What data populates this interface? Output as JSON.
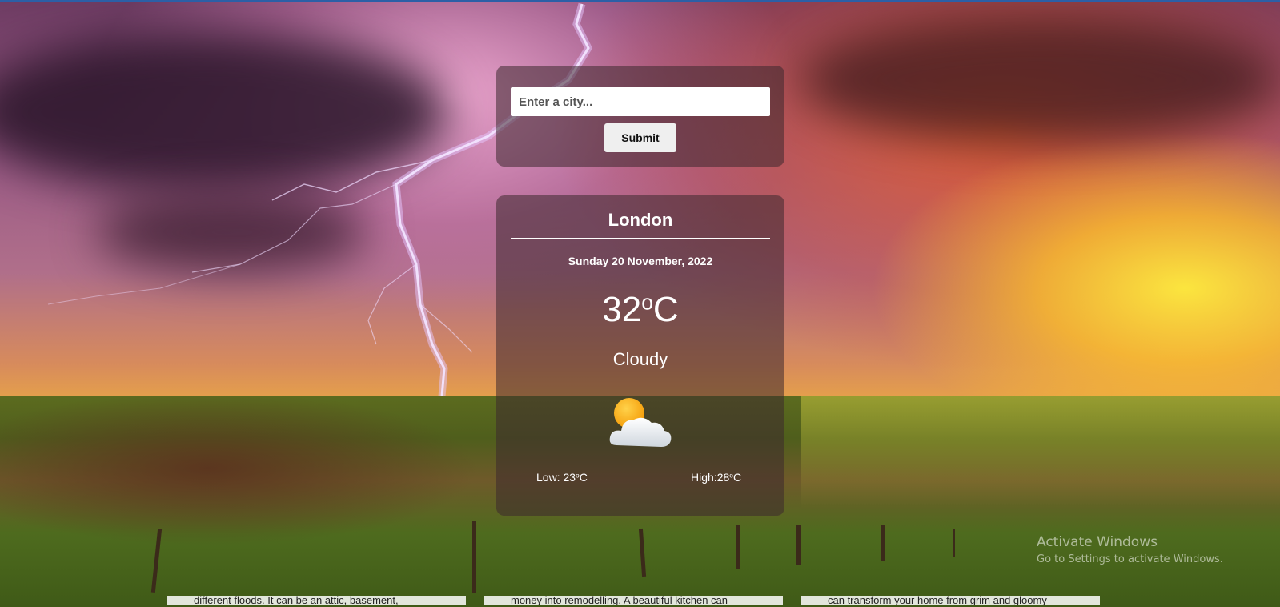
{
  "search": {
    "placeholder": "Enter a city...",
    "submit_label": "Submit"
  },
  "weather": {
    "city": "London",
    "date": "Sunday 20 November, 2022",
    "temperature": "32",
    "degree_symbol": "o",
    "unit": "C",
    "condition": "Cloudy",
    "icon": "partly-cloudy-icon",
    "low_label": "Low: ",
    "low_value": "23",
    "high_label": "High:",
    "high_value": "28"
  },
  "watermark": {
    "title": "Activate Windows",
    "subtitle": "Go to Settings to activate Windows."
  },
  "bottom_snippets": [
    "different floods. It can be an attic, basement,",
    "money into remodelling. A beautiful kitchen can",
    "can transform your home from grim and gloomy"
  ],
  "colors": {
    "panel_bg": "#3c282d",
    "text": "#ffffff",
    "button_bg": "#efefef"
  }
}
